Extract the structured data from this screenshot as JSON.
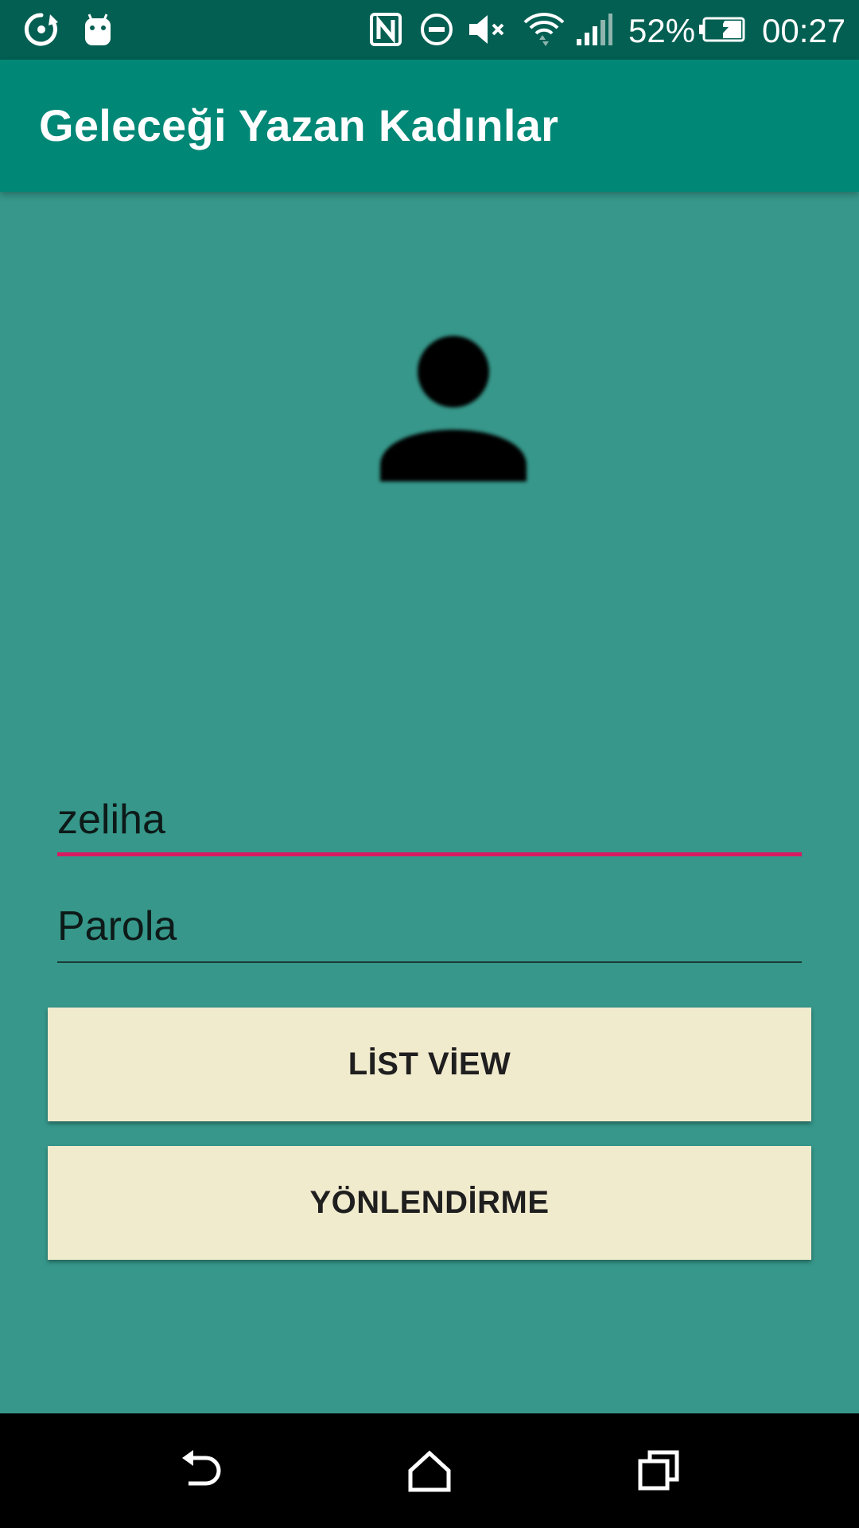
{
  "status_bar": {
    "battery": "52%",
    "time": "00:27",
    "icons": [
      "sync-icon",
      "android-icon",
      "nfc-icon",
      "do-not-disturb-icon",
      "volume-muted-icon",
      "wifi-icon",
      "signal-icon",
      "battery-charging-icon"
    ]
  },
  "app_bar": {
    "title": "Geleceği Yazan Kadınlar"
  },
  "avatar": {
    "icon": "person-icon"
  },
  "form": {
    "username_value": "zeliha",
    "password_placeholder": "Parola"
  },
  "buttons": {
    "list_view": "LİST VİEW",
    "yonlendirme": "YÖNLENDİRME"
  },
  "nav_bar": {
    "icons": [
      "back-icon",
      "home-icon",
      "recents-icon"
    ]
  },
  "colors": {
    "status_bar": "#025f52",
    "app_bar": "#018776",
    "background": "#36978a",
    "button": "#f1ebcd",
    "accent": "#d81b60"
  }
}
